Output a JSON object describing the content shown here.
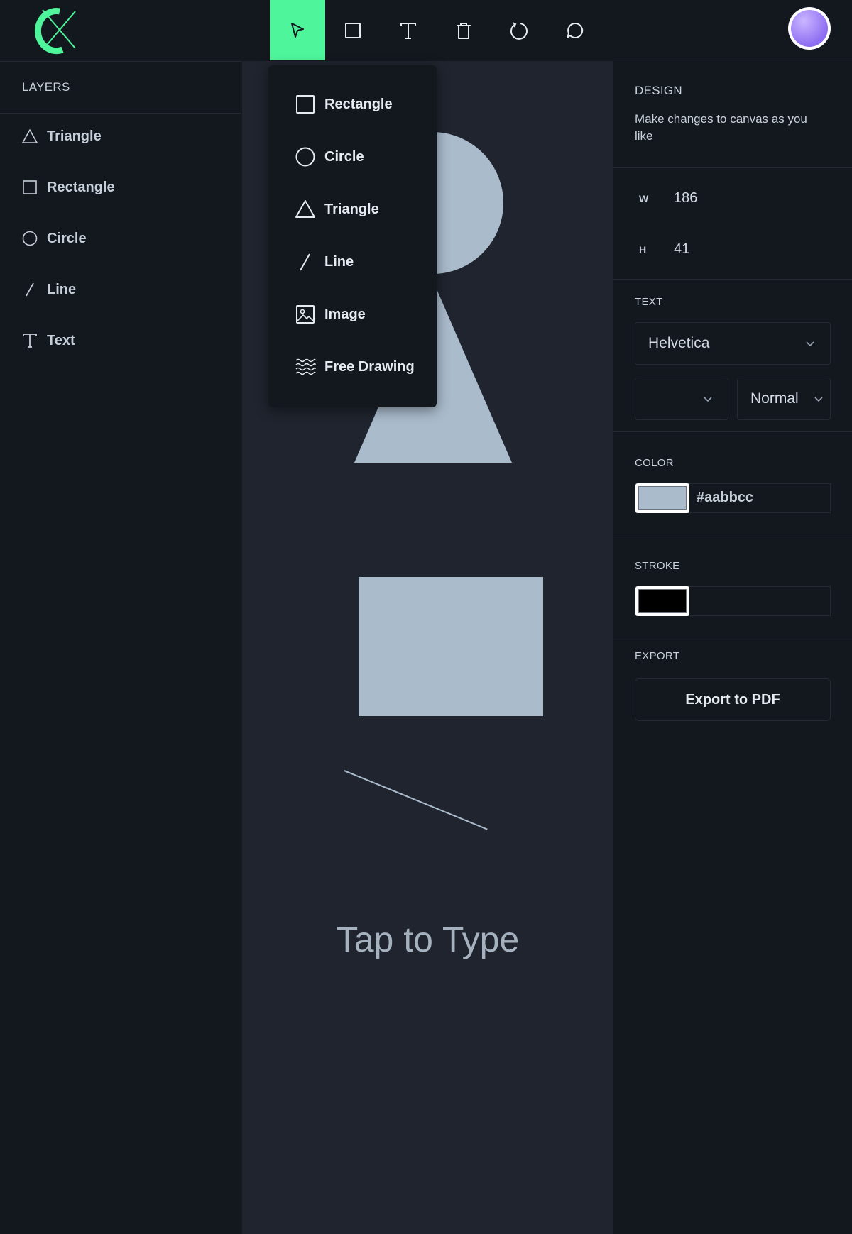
{
  "toolbar": {
    "tools": [
      {
        "name": "select",
        "icon": "cursor-icon",
        "active": true
      },
      {
        "name": "rectangle",
        "icon": "square-icon",
        "active": false
      },
      {
        "name": "text",
        "icon": "text-icon",
        "active": false
      },
      {
        "name": "delete",
        "icon": "trash-icon",
        "active": false
      },
      {
        "name": "reset",
        "icon": "reset-icon",
        "active": false
      },
      {
        "name": "comment",
        "icon": "comment-icon",
        "active": false
      }
    ],
    "accent_color": "#4ef59b"
  },
  "layers": {
    "header": "LAYERS",
    "items": [
      {
        "label": "Triangle",
        "icon": "triangle-icon"
      },
      {
        "label": "Rectangle",
        "icon": "square-icon"
      },
      {
        "label": "Circle",
        "icon": "circle-icon"
      },
      {
        "label": "Line",
        "icon": "line-icon"
      },
      {
        "label": "Text",
        "icon": "text-icon"
      }
    ]
  },
  "shape_menu": {
    "items": [
      {
        "label": "Rectangle",
        "icon": "square-icon"
      },
      {
        "label": "Circle",
        "icon": "circle-icon"
      },
      {
        "label": "Triangle",
        "icon": "triangle-icon"
      },
      {
        "label": "Line",
        "icon": "line-icon"
      },
      {
        "label": "Image",
        "icon": "image-icon"
      },
      {
        "label": "Free Drawing",
        "icon": "waves-icon"
      }
    ]
  },
  "canvas": {
    "text": "Tap to Type",
    "shape_color": "#aabbcc"
  },
  "design": {
    "title": "DESIGN",
    "description": "Make changes to canvas as you like",
    "width_label": "W",
    "width_value": "186",
    "height_label": "H",
    "height_value": "41"
  },
  "text_section": {
    "title": "TEXT",
    "font_family": "Helvetica",
    "font_size": "",
    "font_weight": "Normal"
  },
  "color_section": {
    "title": "COLOR",
    "value": "#aabbcc"
  },
  "stroke_section": {
    "title": "STROKE",
    "value": "",
    "color": "#000000"
  },
  "export_section": {
    "title": "EXPORT",
    "button_label": "Export to PDF"
  }
}
